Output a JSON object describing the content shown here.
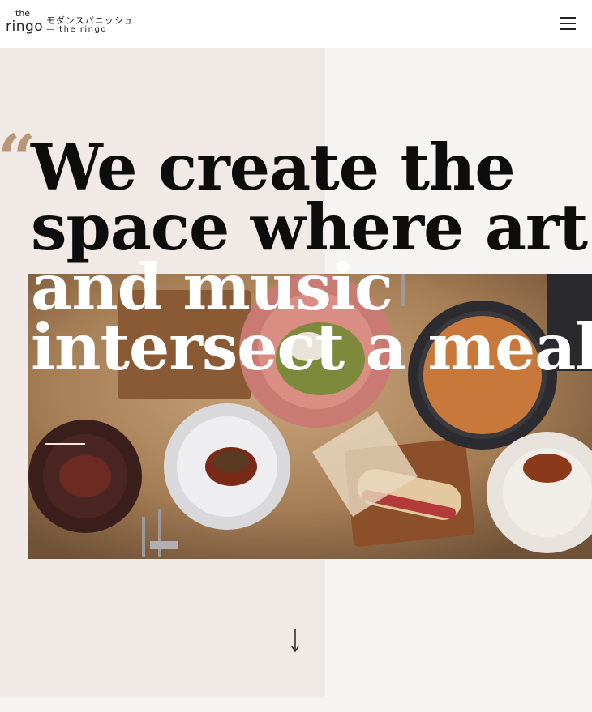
{
  "header": {
    "logo_the": "the",
    "logo_ringo": "ringo",
    "brand_jp": "モダンスパニッシュ",
    "brand_sub": "— the ringo",
    "menu_icon": "hamburger-menu-icon"
  },
  "hero": {
    "quote_mark": "“",
    "headline_lines": [
      "We create the",
      "space where art",
      "and music",
      "intersect a meal."
    ],
    "photo_icon": "food-table-photo",
    "scroll_icon": "arrow-down-icon"
  },
  "colors": {
    "panel_bg": "#f0e9e6",
    "page_bg": "#f6f4f3",
    "quote_accent": "#b89778",
    "headline_dark": "#0d0d0d",
    "headline_light": "#ffffff"
  }
}
